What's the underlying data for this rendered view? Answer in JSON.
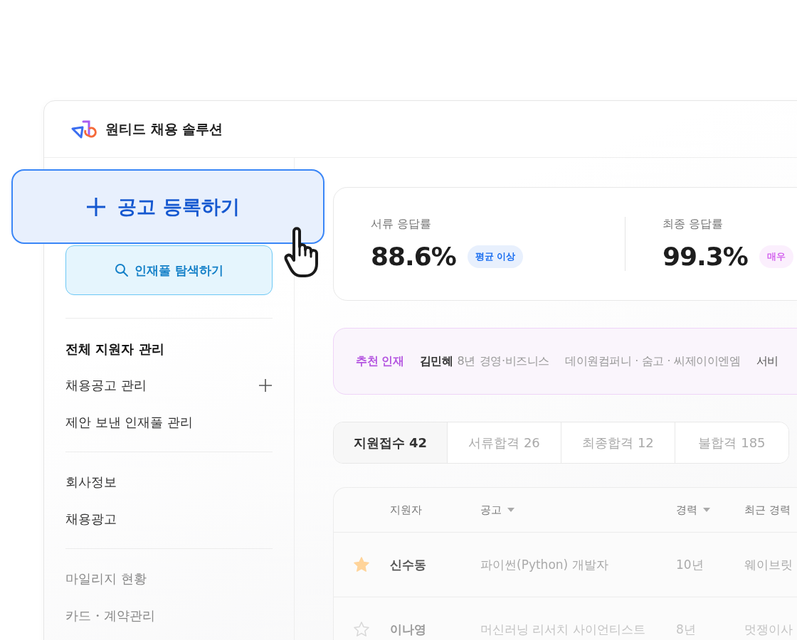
{
  "app": {
    "title": "원티드 채용 솔루션"
  },
  "floating_button": {
    "label": "공고 등록하기"
  },
  "sidebar": {
    "search_button": "인재풀 탐색하기",
    "sections": [
      {
        "items": [
          {
            "label": "전체 지원자 관리",
            "selected": true,
            "addable": false
          },
          {
            "label": "채용공고 관리",
            "selected": false,
            "addable": true
          },
          {
            "label": "제안 보낸 인재풀 관리",
            "selected": false,
            "addable": false
          }
        ]
      },
      {
        "items": [
          {
            "label": "회사정보",
            "selected": false,
            "addable": false
          },
          {
            "label": "채용광고",
            "selected": false,
            "addable": false
          }
        ]
      },
      {
        "items": [
          {
            "label": "마일리지 현황",
            "selected": false,
            "addable": false
          },
          {
            "label": "카드・계약관리",
            "selected": false,
            "addable": false
          }
        ]
      }
    ]
  },
  "stats": [
    {
      "label": "서류 응답률",
      "value": "88.6%",
      "badge": "평균 이상",
      "color": "#1a6ef0"
    },
    {
      "label": "최종 응답률",
      "value": "99.3%",
      "badge": "매우",
      "color": "#d466ee"
    }
  ],
  "recommendation": {
    "label": "추천 인재",
    "name": "김민혜",
    "experience": "8년",
    "field": "경영·비즈니스",
    "companies": "데이원컴퍼니 · 숨고 · 씨제이이엔엠",
    "extra": "서비"
  },
  "tabs": [
    {
      "label": "지원접수 42",
      "selected": true
    },
    {
      "label": "서류합격 26",
      "selected": false
    },
    {
      "label": "최종합격 12",
      "selected": false
    },
    {
      "label": "불합격 185",
      "selected": false
    }
  ],
  "table": {
    "columns": [
      {
        "label": "지원자",
        "sortable": false
      },
      {
        "label": "공고",
        "sortable": true
      },
      {
        "label": "경력",
        "sortable": true
      },
      {
        "label": "최근 경력",
        "sortable": false
      }
    ],
    "rows": [
      {
        "starred": true,
        "name": "신수동",
        "posting": "파이썬(Python) 개발자",
        "experience": "10년",
        "recent": "웨이브릿"
      },
      {
        "starred": false,
        "name": "이나영",
        "posting": "머신러닝 리서치 사이언티스트",
        "experience": "8년",
        "recent": "멋쟁이사"
      }
    ]
  }
}
